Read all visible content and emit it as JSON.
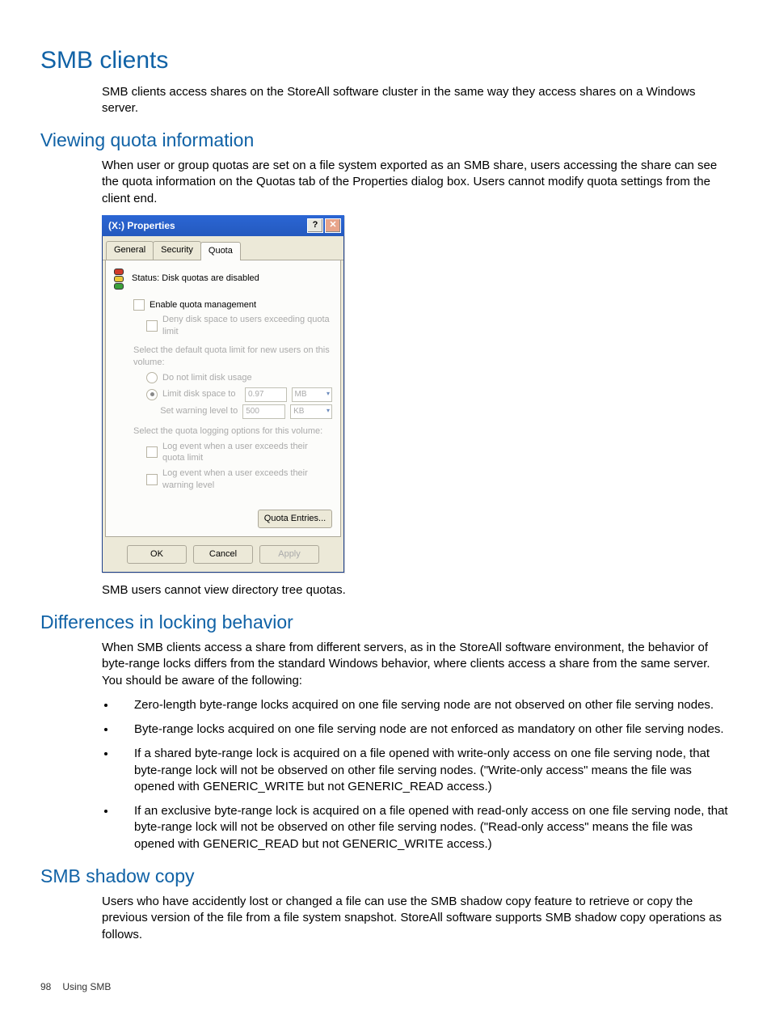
{
  "headings": {
    "h1": "SMB clients",
    "h2_viewing": "Viewing quota information",
    "h2_diff": "Differences in locking behavior",
    "h2_shadow": "SMB shadow copy"
  },
  "paragraphs": {
    "p_smb_intro": "SMB clients access shares on the StoreAll software cluster in the same way they access shares on a Windows server.",
    "p_viewing": "When user or group quotas are set on a file system exported as an SMB share, users accessing the share can see the quota information on the Quotas tab of the Properties dialog box. Users cannot modify quota settings from the client end.",
    "p_after_dialog": "SMB users cannot view directory tree quotas.",
    "p_diff_intro": "When SMB clients access a share from different servers, as in the StoreAll software environment, the behavior of byte-range locks differs from the standard Windows behavior, where clients access a share from the same server. You should be aware of the following:",
    "p_shadow": "Users who have accidently lost or changed a file can use the SMB shadow copy feature to retrieve or copy the previous version of the file from a file system snapshot. StoreAll software supports SMB shadow copy operations as follows."
  },
  "bullets": [
    "Zero-length byte-range locks acquired on one file serving node are not observed on other file serving nodes.",
    "Byte-range locks acquired on one file serving node are not enforced as mandatory on other file serving nodes.",
    "If a shared byte-range lock is acquired on a file opened with write-only access on one file serving node, that byte-range lock will not be observed on other file serving nodes. (\"Write-only access\" means the file was opened with GENERIC_WRITE but not GENERIC_READ access.)",
    "If an exclusive byte-range lock is acquired on a file opened with read-only access on one file serving node, that byte-range lock will not be observed on other file serving nodes. (\"Read-only access\" means the file was opened with GENERIC_READ but not GENERIC_WRITE access.)"
  ],
  "dialog": {
    "title": "(X:) Properties",
    "help": "?",
    "close": "✕",
    "tabs": {
      "general": "General",
      "security": "Security",
      "quota": "Quota"
    },
    "status_label": "Status:  Disk quotas are disabled",
    "enable_quota": "Enable quota management",
    "deny_space": "Deny disk space to users exceeding quota limit",
    "default_limit_label": "Select the default quota limit for new users on this volume:",
    "no_limit": "Do not limit disk usage",
    "limit_to": "Limit disk space to",
    "limit_val": "0.97",
    "limit_unit": "MB",
    "warn_to": "Set warning level to",
    "warn_val": "500",
    "warn_unit": "KB",
    "logging_label": "Select the quota logging options for this volume:",
    "log_quota": "Log event when a user exceeds their quota limit",
    "log_warn": "Log event when a user exceeds their warning level",
    "entries_btn": "Quota Entries...",
    "ok": "OK",
    "cancel": "Cancel",
    "apply": "Apply"
  },
  "footer": {
    "page": "98",
    "section": "Using SMB"
  }
}
